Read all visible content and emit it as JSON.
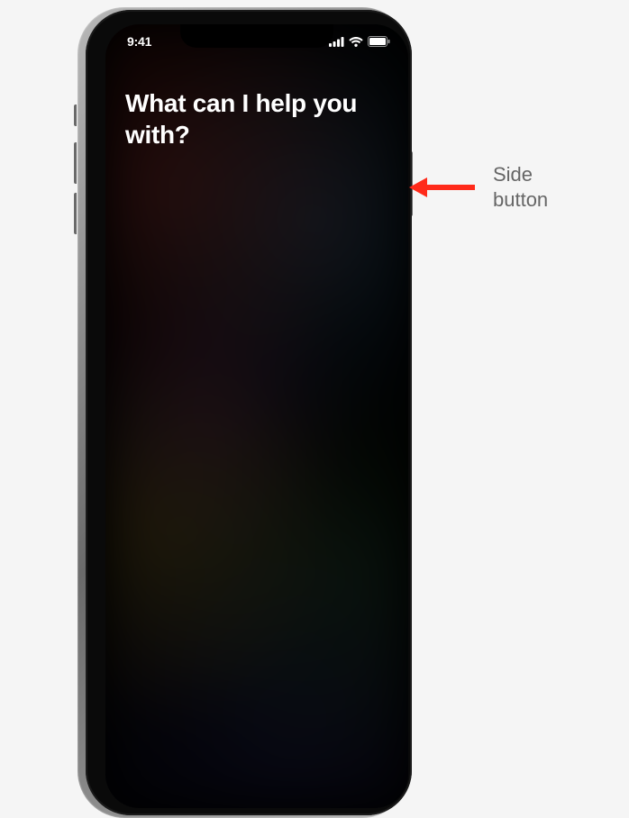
{
  "status_bar": {
    "time": "9:41"
  },
  "siri": {
    "prompt": "What can I help you with?"
  },
  "callout": {
    "label": "Side button"
  }
}
